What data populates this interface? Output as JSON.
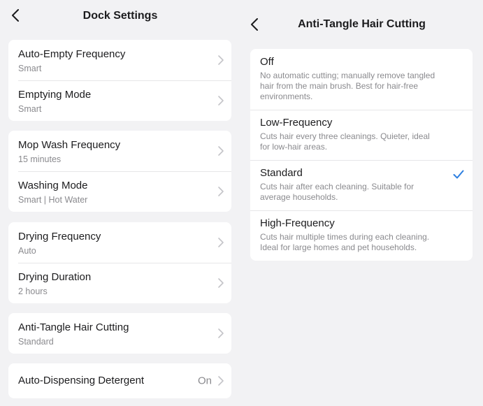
{
  "left": {
    "title": "Dock Settings",
    "groups": [
      {
        "items": [
          {
            "label": "Auto-Empty Frequency",
            "value": "Smart"
          },
          {
            "label": "Emptying Mode",
            "value": "Smart"
          }
        ]
      },
      {
        "items": [
          {
            "label": "Mop Wash Frequency",
            "value": "15 minutes"
          },
          {
            "label": "Washing Mode",
            "value": "Smart | Hot Water"
          }
        ]
      },
      {
        "items": [
          {
            "label": "Drying Frequency",
            "value": "Auto"
          },
          {
            "label": "Drying Duration",
            "value": "2 hours"
          }
        ]
      },
      {
        "items": [
          {
            "label": "Anti-Tangle Hair Cutting",
            "value": "Standard"
          }
        ]
      },
      {
        "items": [
          {
            "label": "Auto-Dispensing Detergent",
            "trailing": "On"
          }
        ]
      }
    ]
  },
  "right": {
    "title": "Anti-Tangle Hair Cutting",
    "selected_index": 2,
    "options": [
      {
        "name": "Off",
        "description": "No automatic cutting; manually remove tangled hair from the main brush. Best for hair-free environments."
      },
      {
        "name": "Low-Frequency",
        "description": "Cuts hair every three cleanings. Quieter, ideal for low-hair areas."
      },
      {
        "name": "Standard",
        "description": "Cuts hair after each cleaning. Suitable for average households."
      },
      {
        "name": "High-Frequency",
        "description": "Cuts hair multiple times during each cleaning. Ideal for large homes and pet households."
      }
    ]
  },
  "colors": {
    "accent": "#2d7fe0",
    "background": "#f2f2f4",
    "chevron": "#c4c4c8"
  },
  "icons": {
    "back": "chevron-left-icon",
    "disclosure": "chevron-right-icon",
    "selected": "checkmark-icon"
  }
}
